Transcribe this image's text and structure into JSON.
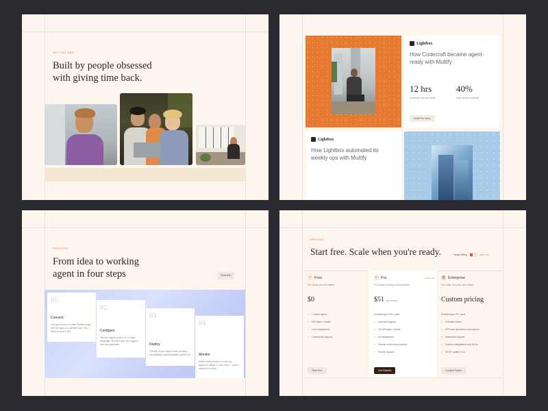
{
  "panel1": {
    "eyebrow": "WHY WE ARE",
    "heading_line1": "Built by people obsessed",
    "heading_line2": "with giving time back."
  },
  "panel2": {
    "brand": "Lightbox",
    "card1_title": "How Codecraft became agent-ready with Multify",
    "stat1_value": "12 hrs",
    "stat1_label": "saved per rep, per week",
    "stat2_value": "40%",
    "stat2_label": "more deals contacted",
    "read_button": "Read the story",
    "card2_title": "How Lightbox automated its weekly ops with Multify"
  },
  "panel3": {
    "eyebrow": "PROCESS",
    "heading_line1": "From idea to working",
    "heading_line2": "agent in four steps",
    "start_button": "Start free",
    "steps": [
      {
        "num": "01.",
        "title": "Connect",
        "desc": "Link your tools in a click. Multify plugs into the apps you already use, from Slack to your CRM."
      },
      {
        "num": "02.",
        "title": "Configure",
        "desc": "Tell your agent what to do in plain language. Set the rules, the triggers, and the guardrails."
      },
      {
        "num": "03.",
        "title": "Deploy",
        "desc": "Overall of your agent starts working immediately, handling tasks as they hit."
      },
      {
        "num": "04.",
        "title": "Monitor",
        "desc": "Watch every action in a live log. Approve, adjust, or roll it out — you're always in control."
      }
    ]
  },
  "panel4": {
    "eyebrow": "PRICING",
    "heading": "Start free. Scale when you're ready.",
    "billing_label": "Yearly billing",
    "billing_save": "SAVE 15%",
    "plans": [
      {
        "name": "Free",
        "icon": "arrow-up-right-icon",
        "desc": "For trying your first agent",
        "price": "$0",
        "period": "",
        "features_head": "",
        "features": [
          "1 active agent",
          "500 tasks / month",
          "Core integrations",
          "Community support"
        ],
        "button": "Start free"
      },
      {
        "name": "Pro",
        "icon": "lightning-icon",
        "badge": "POPULAR",
        "desc": "For teams running real workflows",
        "price": "$51",
        "period": "per month",
        "features_head": "Everything in Free, plus:",
        "features": [
          "Unlimited agents",
          "10,000 tasks / month",
          "All integrations",
          "Human-in-the-loop controls",
          "Priority support"
        ],
        "button": "Get Started"
      },
      {
        "name": "Enterprise",
        "icon": "building-icon",
        "desc": "For scale, security, and control",
        "price": "Custom pricing",
        "period": "",
        "features_head": "Everything in Pro, plus:",
        "features": [
          "Unlimited tasks",
          "SSO and advanced permissions",
          "Dedicated support",
          "Custom integrations and SLAs",
          "99.9% uptime SLA"
        ],
        "button": "Contact Sales"
      }
    ]
  }
}
